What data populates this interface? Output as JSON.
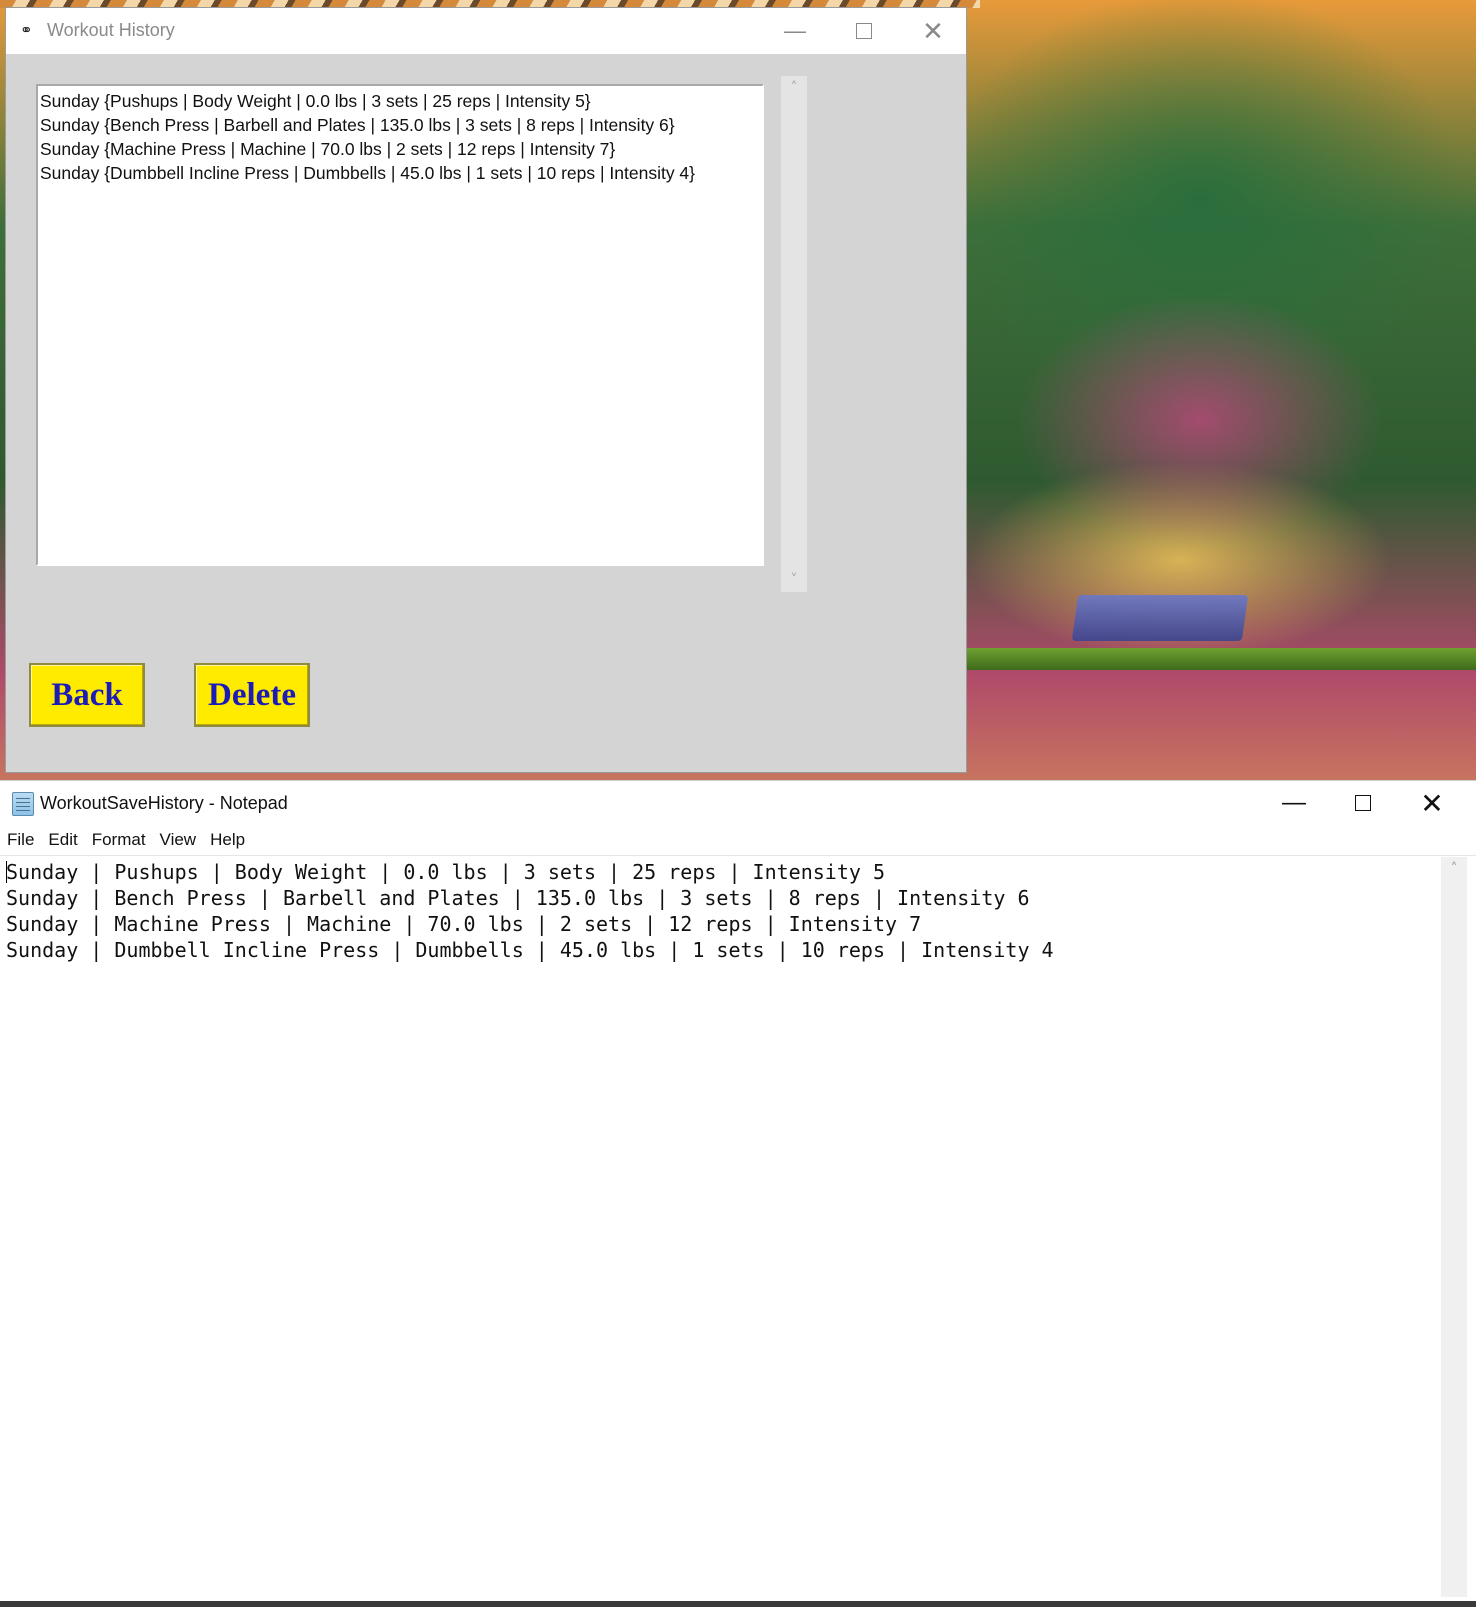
{
  "workout_history_window": {
    "title": "Workout History",
    "app_icon": "binoculars-icon",
    "controls": {
      "minimize": "—",
      "close": "✕"
    },
    "history_entries": [
      "Sunday {Pushups | Body Weight | 0.0 lbs | 3 sets | 25 reps | Intensity 5}",
      "Sunday {Bench Press | Barbell and Plates | 135.0 lbs | 3 sets | 8 reps | Intensity 6}",
      "Sunday {Machine Press | Machine | 70.0 lbs | 2 sets | 12 reps | Intensity 7}",
      "Sunday {Dumbbell Incline Press | Dumbbells | 45.0 lbs | 1 sets | 10 reps | Intensity 4}"
    ],
    "scrollbar": {
      "up": "˄",
      "down": "˅"
    },
    "buttons": {
      "back": "Back",
      "delete": "Delete"
    },
    "button_color": "#ffeb00",
    "button_text_color": "#1b1bb8"
  },
  "notepad_window": {
    "title": "WorkoutSaveHistory - Notepad",
    "app_icon": "notepad-icon",
    "controls": {
      "minimize": "—",
      "close": "✕"
    },
    "menu": [
      "File",
      "Edit",
      "Format",
      "View",
      "Help"
    ],
    "lines": [
      "Sunday | Pushups | Body Weight | 0.0 lbs | 3 sets | 25 reps | Intensity 5",
      "Sunday | Bench Press | Barbell and Plates | 135.0 lbs | 3 sets | 8 reps | Intensity 6",
      "Sunday | Machine Press | Machine | 70.0 lbs | 2 sets | 12 reps | Intensity 7",
      "Sunday | Dumbbell Incline Press | Dumbbells | 45.0 lbs | 1 sets | 10 reps | Intensity 4"
    ],
    "scrollbar": {
      "up": "˄"
    }
  }
}
